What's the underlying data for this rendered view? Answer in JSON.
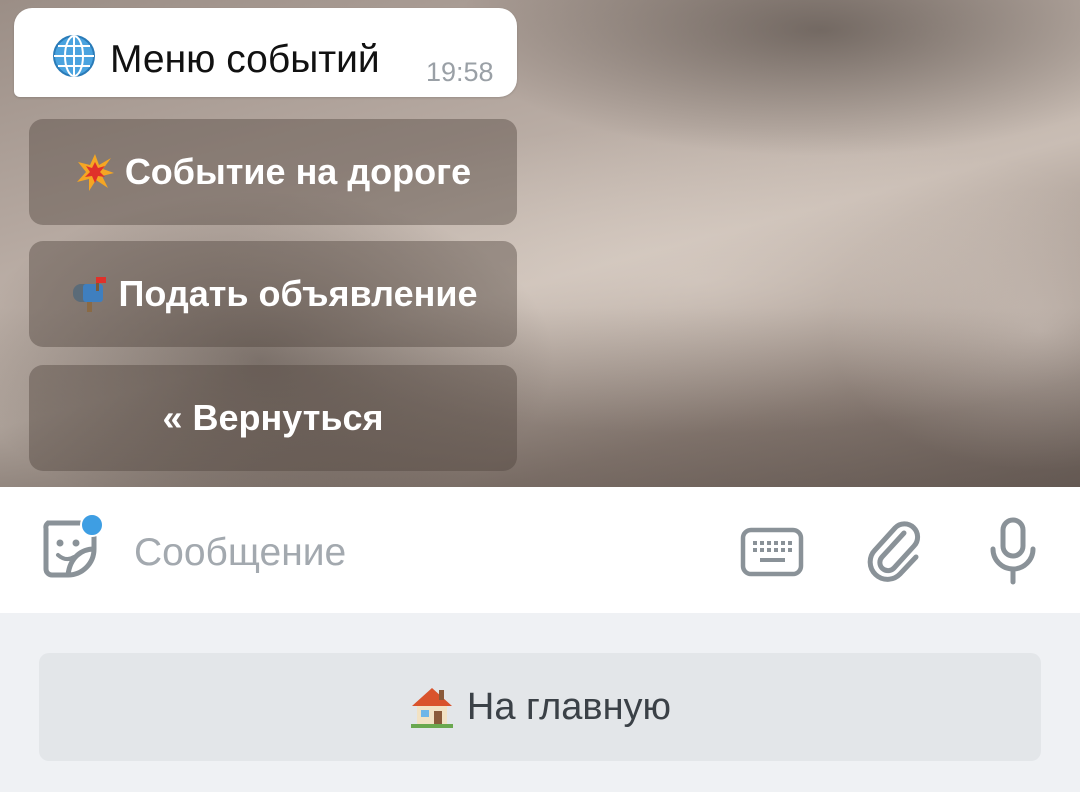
{
  "message": {
    "title": "Меню событий",
    "time": "19:58",
    "icon": "globe-icon"
  },
  "inline_keyboard": [
    {
      "label": "Событие на дороге",
      "icon": "collision-icon"
    },
    {
      "label": "Подать объявление",
      "icon": "mailbox-icon"
    },
    {
      "label": "« Вернуться"
    }
  ],
  "composer": {
    "placeholder": "Сообщение",
    "accent": "#3e9ee3"
  },
  "reply_keyboard": {
    "label": "На главную",
    "icon": "house-icon"
  }
}
